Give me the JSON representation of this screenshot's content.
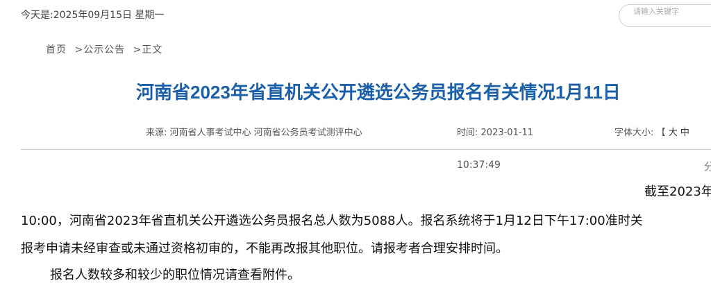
{
  "header": {
    "date_text": "今天是:2025年09月15日  星期一",
    "search_placeholder": "请输入关键字"
  },
  "breadcrumb": {
    "items": [
      "首页",
      "公示公告",
      "正文"
    ],
    "separator": ">"
  },
  "article": {
    "title": "河南省2023年省直机关公开遴选公务员报名有关情况1月11日",
    "source_label": "来源:",
    "source": "河南省人事考试中心 河南省公务员考试测评中心",
    "time_label": "时间:",
    "time": "2023-01-11",
    "time_cont": "10:37:49",
    "font_size_label": "字体大小:",
    "font_size_options": [
      "【",
      "大",
      "中"
    ],
    "share_glyph": "分",
    "paragraphs": [
      "截至2023年",
      "10:00，河南省2023年省直机关公开遴选公务员报名总人数为5088人。报名系统将于1月12日下午17:00准时关",
      "报考申请未经审查或未通过资格初审的，不能再改报其他职位。请报考者合理安排时间。",
      "报名人数较多和较少的职位情况请查看附件。"
    ]
  },
  "colors": {
    "title": "#1a5fa8",
    "text": "#111111",
    "meta": "#555555",
    "divider": "#cccccc"
  }
}
